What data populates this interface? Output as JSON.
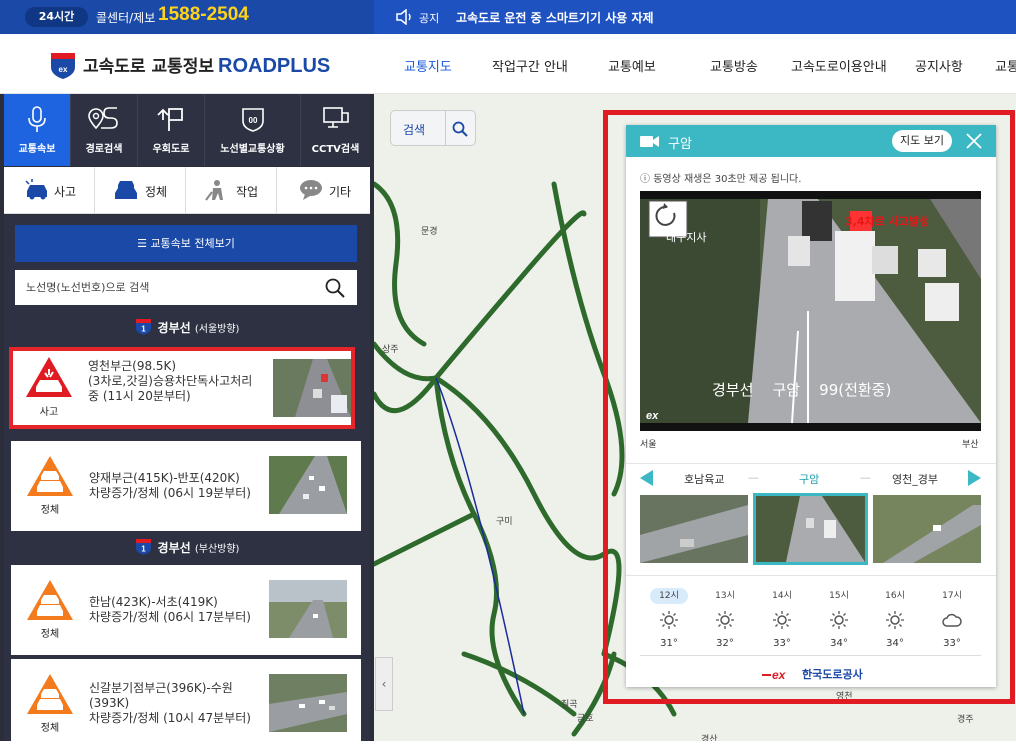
{
  "top": {
    "hours": "24시간",
    "callcenter": "콜센터/제보",
    "phone": "1588-2504",
    "notice_label": "공지",
    "notice_text": "고속도로 운전 중 스마트기기 사용 자제"
  },
  "header": {
    "brand": "고속도로 교통정보",
    "brand_en": "ROADPLUS",
    "nav": [
      "교통지도",
      "작업구간 안내",
      "교통예보",
      "교통방송",
      "고속도로이용안내",
      "공지사항",
      "교통"
    ]
  },
  "side_tabs": [
    "교통속보",
    "경로검색",
    "우회도로",
    "노선별교통상황",
    "CCTV검색"
  ],
  "filters": [
    "사고",
    "정체",
    "작업",
    "기타"
  ],
  "list": {
    "all_button": "교통속보 전체보기",
    "search_placeholder": "노선명(노선번호)으로 검색",
    "route1": {
      "no": "1",
      "name": "경부선",
      "dir": "(서울방향)"
    },
    "route2": {
      "no": "1",
      "name": "경부선",
      "dir": "(부산방향)"
    },
    "items": [
      {
        "type": "사고",
        "text": "영천부근(98.5K)\n(3차로,갓길)승용차단독사고처리중 (11시 20분부터)"
      },
      {
        "type": "정체",
        "text": "양재부근(415K)-반포(420K)\n차량증가/정체 (06시 19분부터)"
      },
      {
        "type": "정체",
        "text": "한남(423K)-서초(419K)\n차량증가/정체 (06시 17분부터)"
      },
      {
        "type": "정체",
        "text": "신갈분기점부근(396K)-수원(393K)\n차량증가/정체 (10시 47분부터)"
      }
    ]
  },
  "map": {
    "search": "검색",
    "labels": [
      "문경",
      "상주",
      "구미",
      "칠곡",
      "금호",
      "영천",
      "경산",
      "경주"
    ]
  },
  "popup": {
    "title": "구암",
    "map_button": "지도 보기",
    "notice": "동영상 재생은 30초만 제공 됩니다.",
    "video_caption": "경부선    구암    99(전환중)",
    "video_overlay_top": "대구지사",
    "video_overlay_red": "3,4차로 사고발생",
    "dir_left": "서울",
    "dir_right": "부산",
    "cams": [
      "호남육교",
      "구암",
      "영천_경부"
    ],
    "weather": [
      {
        "hour": "12시",
        "temp": "31°",
        "icon": "sun-icon"
      },
      {
        "hour": "13시",
        "temp": "32°",
        "icon": "sun-icon"
      },
      {
        "hour": "14시",
        "temp": "33°",
        "icon": "sun-icon"
      },
      {
        "hour": "15시",
        "temp": "34°",
        "icon": "sun-icon"
      },
      {
        "hour": "16시",
        "temp": "34°",
        "icon": "sun-icon"
      },
      {
        "hour": "17시",
        "temp": "33°",
        "icon": "cloud-icon"
      }
    ],
    "org": "한국도로공사"
  },
  "colors": {
    "brand_blue": "#1a49a8",
    "accent_teal": "#3bb8c4",
    "alert_red": "#e01b22",
    "jam_orange": "#f37b1d"
  }
}
